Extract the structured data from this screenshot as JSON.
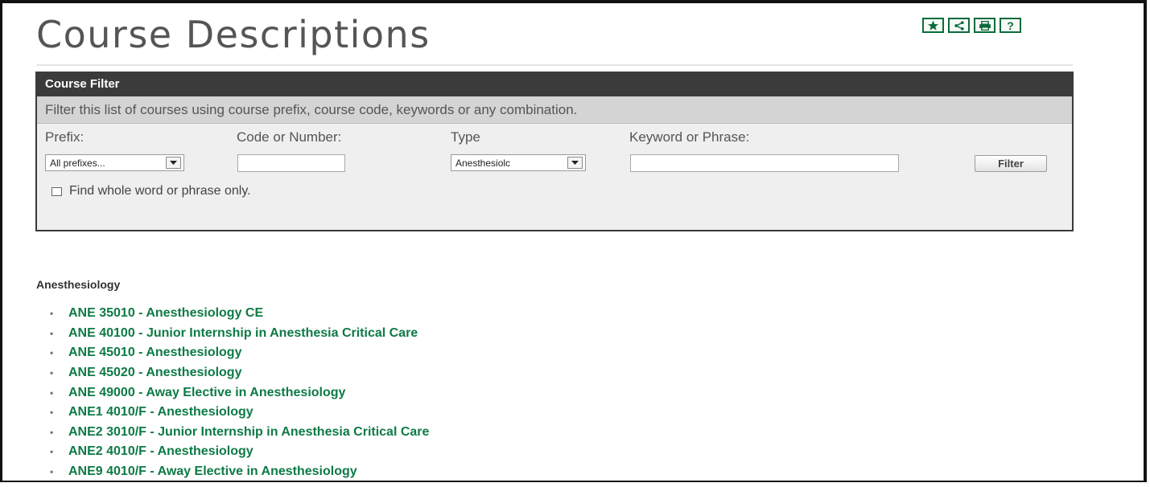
{
  "page": {
    "title": "Course Descriptions"
  },
  "toolbar": {
    "icons": [
      "star-icon",
      "share-icon",
      "print-icon",
      "help-icon"
    ],
    "help_glyph": "?",
    "accent": "#0b6b3a"
  },
  "filter": {
    "heading": "Course Filter",
    "description": "Filter this list of courses using course prefix, course code, keywords or any combination.",
    "prefix_label": "Prefix:",
    "prefix_value": "All prefixes...",
    "code_label": "Code or Number:",
    "code_value": "",
    "type_label": "Type",
    "type_value": "Anesthesiolc",
    "keyword_label": "Keyword or Phrase:",
    "keyword_value": "",
    "button_label": "Filter",
    "whole_word_label": "Find whole word or phrase only.",
    "whole_word_checked": false
  },
  "results": {
    "heading": "Anesthesiology",
    "bullet": "•",
    "link_color": "#0d7a45",
    "courses": [
      "ANE 35010  - Anesthesiology CE",
      "ANE 40100  - Junior Internship in Anesthesia Critical Care",
      "ANE 45010  - Anesthesiology",
      "ANE 45020  - Anesthesiology",
      "ANE 49000  - Away Elective in Anesthesiology",
      "ANE1 4010/F  - Anesthesiology",
      "ANE2 3010/F  - Junior Internship in Anesthesia Critical Care",
      "ANE2 4010/F  - Anesthesiology",
      "ANE9 4010/F  - Away Elective in Anesthesiology"
    ]
  }
}
